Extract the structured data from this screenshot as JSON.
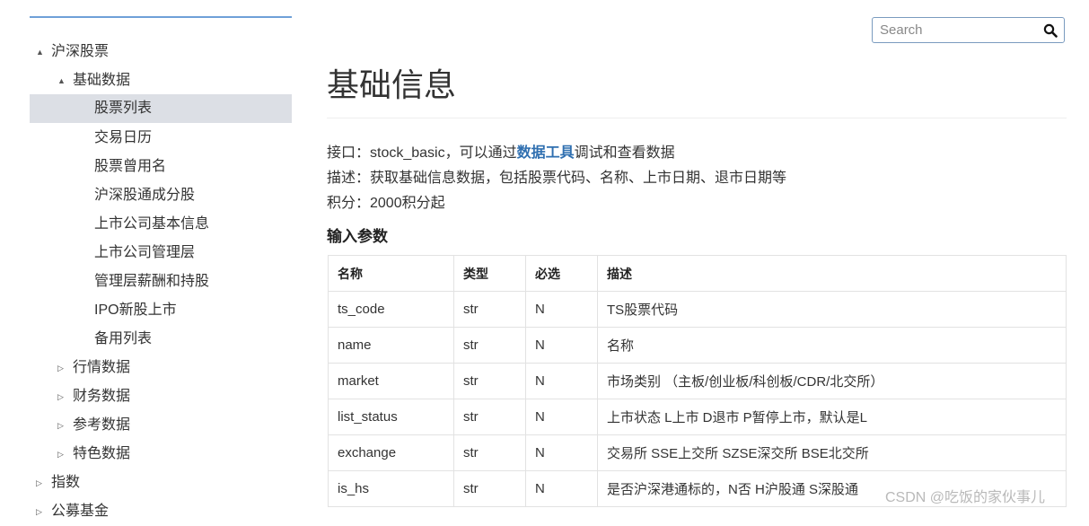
{
  "sidebar": {
    "items": [
      {
        "label": "沪深股票",
        "expanded": true,
        "arrow": "▲",
        "level": 0
      },
      {
        "label": "基础数据",
        "expanded": true,
        "arrow": "▲",
        "level": 1
      },
      {
        "label": "股票列表",
        "level": 2,
        "selected": true
      },
      {
        "label": "交易日历",
        "level": 2
      },
      {
        "label": "股票曾用名",
        "level": 2
      },
      {
        "label": "沪深股通成分股",
        "level": 2
      },
      {
        "label": "上市公司基本信息",
        "level": 2
      },
      {
        "label": "上市公司管理层",
        "level": 2
      },
      {
        "label": "管理层薪酬和持股",
        "level": 2
      },
      {
        "label": "IPO新股上市",
        "level": 2
      },
      {
        "label": "备用列表",
        "level": 2
      },
      {
        "label": "行情数据",
        "expanded": false,
        "arrow": "▷",
        "level": 1
      },
      {
        "label": "财务数据",
        "expanded": false,
        "arrow": "▷",
        "level": 1
      },
      {
        "label": "参考数据",
        "expanded": false,
        "arrow": "▷",
        "level": 1
      },
      {
        "label": "特色数据",
        "expanded": false,
        "arrow": "▷",
        "level": 1
      },
      {
        "label": "指数",
        "expanded": false,
        "arrow": "▷",
        "level": 0
      },
      {
        "label": "公募基金",
        "expanded": false,
        "arrow": "▷",
        "level": 0
      }
    ]
  },
  "search": {
    "placeholder": "Search"
  },
  "main": {
    "title": "基础信息",
    "interface_prefix": "接口：stock_basic，可以通过",
    "interface_link": "数据工具",
    "interface_suffix": "调试和查看数据",
    "description": "描述：获取基础信息数据，包括股票代码、名称、上市日期、退市日期等",
    "points": "积分：2000积分起",
    "section_title": "输入参数"
  },
  "table": {
    "headers": [
      "名称",
      "类型",
      "必选",
      "描述"
    ],
    "rows": [
      [
        "ts_code",
        "str",
        "N",
        "TS股票代码"
      ],
      [
        "name",
        "str",
        "N",
        "名称"
      ],
      [
        "market",
        "str",
        "N",
        "市场类别 （主板/创业板/科创板/CDR/北交所）"
      ],
      [
        "list_status",
        "str",
        "N",
        "上市状态 L上市 D退市 P暂停上市，默认是L"
      ],
      [
        "exchange",
        "str",
        "N",
        "交易所 SSE上交所 SZSE深交所 BSE北交所"
      ],
      [
        "is_hs",
        "str",
        "N",
        "是否沪深港通标的，N否 H沪股通 S深股通"
      ]
    ]
  },
  "watermark": "CSDN @吃饭的家伙事儿"
}
